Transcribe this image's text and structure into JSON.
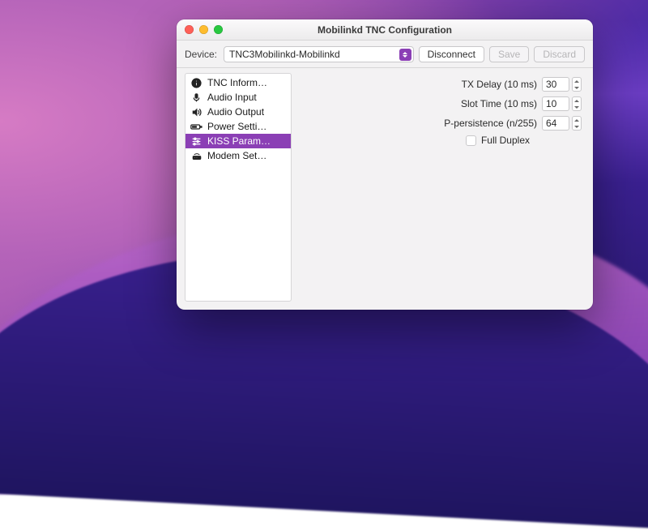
{
  "window": {
    "title": "Mobilinkd TNC Configuration"
  },
  "toolbar": {
    "device_label": "Device:",
    "device_value": "TNC3Mobilinkd-Mobilinkd",
    "disconnect": "Disconnect",
    "save": "Save",
    "discard": "Discard"
  },
  "sidebar": {
    "items": [
      {
        "label": "TNC Inform…",
        "icon": "info-icon"
      },
      {
        "label": "Audio Input",
        "icon": "mic-icon"
      },
      {
        "label": "Audio Output",
        "icon": "speaker-icon"
      },
      {
        "label": "Power Setti…",
        "icon": "battery-icon"
      },
      {
        "label": "KISS Param…",
        "icon": "sliders-icon",
        "selected": true
      },
      {
        "label": "Modem Set…",
        "icon": "modem-icon"
      }
    ]
  },
  "kiss": {
    "tx_delay_label": "TX Delay (10 ms)",
    "tx_delay_value": "30",
    "slot_time_label": "Slot Time (10 ms)",
    "slot_time_value": "10",
    "p_persist_label": "P-persistence (n/255)",
    "p_persist_value": "64",
    "full_duplex_label": "Full Duplex",
    "full_duplex_checked": false
  }
}
